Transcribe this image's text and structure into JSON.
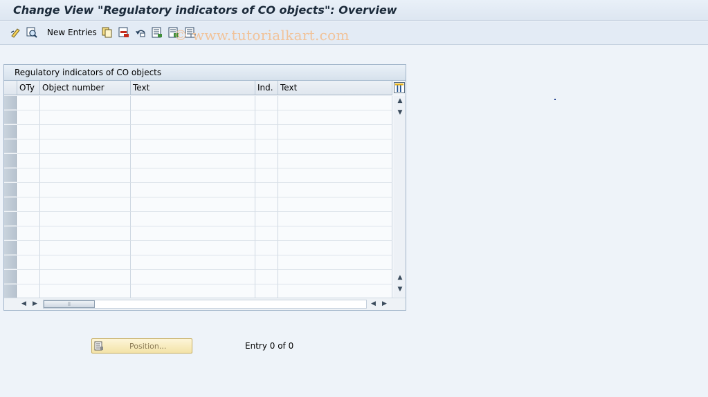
{
  "window": {
    "title": "Change View \"Regulatory indicators of CO objects\": Overview"
  },
  "toolbar": {
    "new_entries_label": "New Entries",
    "icons": [
      "display-change-icon",
      "details-icon",
      "copy-icon",
      "delete-icon",
      "undo-icon",
      "select-all-icon",
      "select-block-icon",
      "deselect-all-icon"
    ],
    "watermark": "© www.tutorialkart.com"
  },
  "table": {
    "title": "Regulatory indicators of CO objects",
    "columns": [
      "OTy",
      "Object number",
      "Text",
      "Ind.",
      "Text"
    ],
    "rows": [],
    "empty_row_count": 14
  },
  "footer": {
    "position_button_label": "Position...",
    "entry_status": "Entry 0 of 0"
  },
  "colors": {
    "accent": "#f3e3a8",
    "header_bg": "#dde6f1",
    "watermark": "#f1c39a"
  }
}
